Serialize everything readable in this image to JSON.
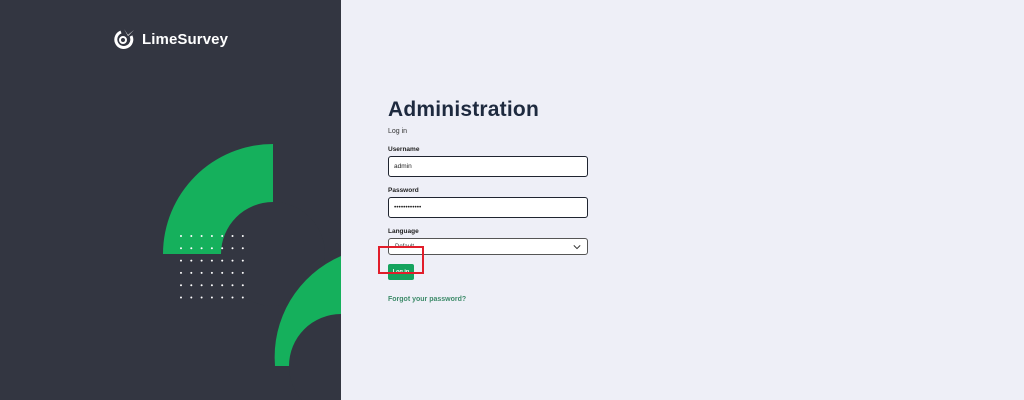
{
  "brand": {
    "name": "LimeSurvey"
  },
  "page": {
    "title": "Administration",
    "subtitle": "Log in"
  },
  "form": {
    "username": {
      "label": "Username",
      "value": "admin"
    },
    "password": {
      "label": "Password",
      "value": "••••••••••••"
    },
    "language": {
      "label": "Language",
      "selected": "Default"
    },
    "login_button": "Log in",
    "forgot_link": "Forgot your password?"
  },
  "colors": {
    "sidebar": "#333641",
    "accent": "#15a35e",
    "page_bg": "#eeeff7",
    "highlight": "#e11d2a"
  }
}
